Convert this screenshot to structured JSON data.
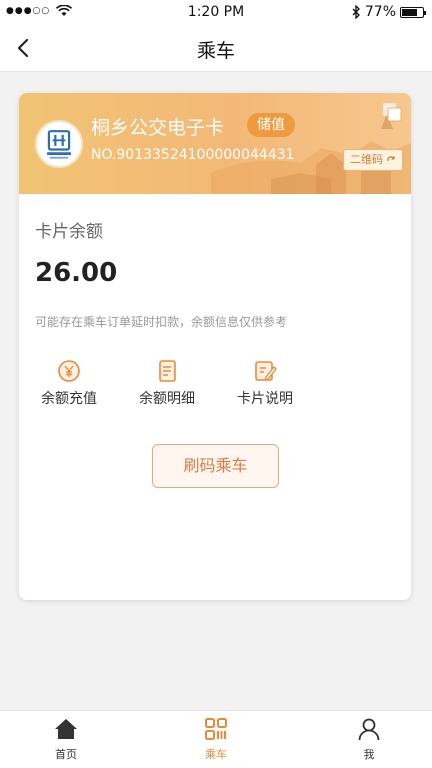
{
  "status_bar": {
    "time": "1:20 PM",
    "battery_percent": "77%",
    "battery_level": 0.77
  },
  "nav": {
    "title": "乘车"
  },
  "card": {
    "title": "桐乡公交电子卡",
    "badge": "储值",
    "number": "NO.90133524100000044431",
    "qr_button": "二维码",
    "balance_label": "卡片余额",
    "balance": "26.00",
    "note": "可能存在乘车订单延时扣款，余额信息仅供参考"
  },
  "actions": [
    {
      "label": "余额充值",
      "icon": "recharge-icon"
    },
    {
      "label": "余额明细",
      "icon": "details-icon"
    },
    {
      "label": "卡片说明",
      "icon": "card-info-icon"
    }
  ],
  "ride_button": "刷码乘车",
  "tabs": [
    {
      "label": "首页",
      "icon": "home-icon"
    },
    {
      "label": "乘车",
      "icon": "ride-icon",
      "active": true
    },
    {
      "label": "我",
      "icon": "user-icon"
    }
  ],
  "colors": {
    "accent": "#e98a3b",
    "card_gradient_start": "#f1c474",
    "card_gradient_end": "#f7c78e"
  }
}
